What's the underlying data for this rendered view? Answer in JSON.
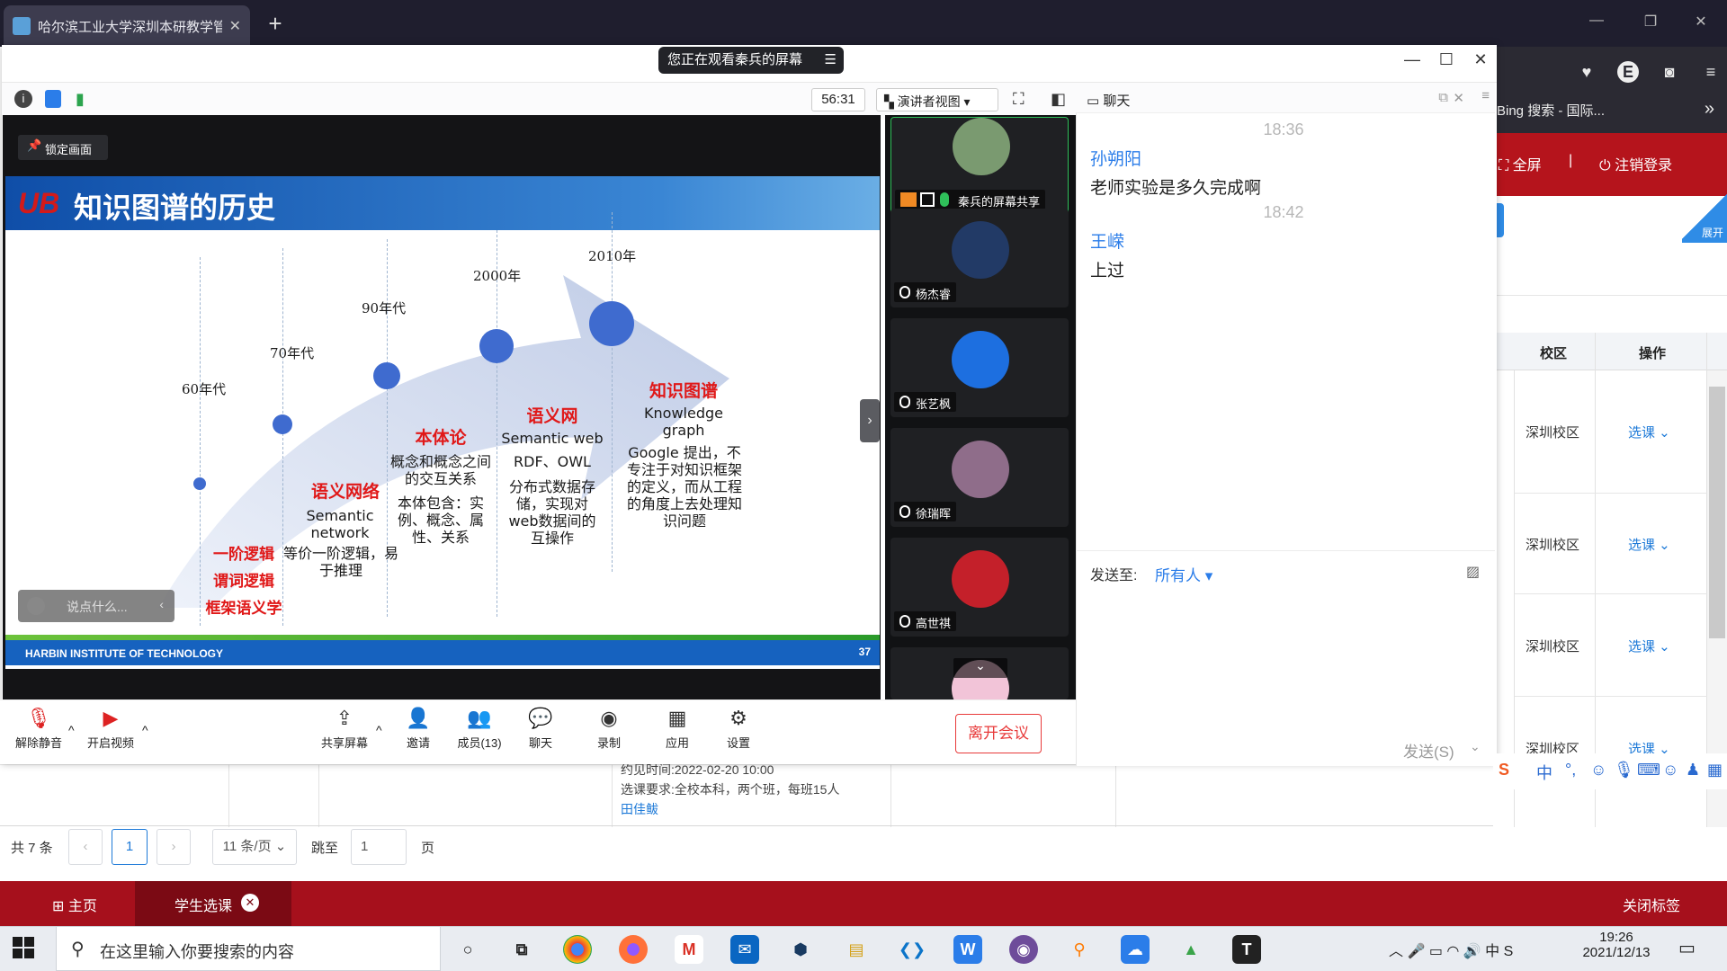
{
  "browser": {
    "tab_title": "哈尔滨工业大学深圳本研教学管",
    "bing_tab": "Bing 搜索 - 国际...",
    "nav_fullscreen": "全屏",
    "nav_logout": "注销登录",
    "expand_label": "展开"
  },
  "under_page": {
    "table_headers": [
      "校区",
      "操作"
    ],
    "rows": [
      {
        "campus": "深圳校区",
        "action": "选课 ⌄"
      },
      {
        "campus": "深圳校区",
        "action": "选课 ⌄"
      },
      {
        "campus": "深圳校区",
        "action": "选课 ⌄"
      },
      {
        "campus": "深圳校区",
        "action": "选课 ⌄"
      }
    ],
    "detail_line1": "约见时间:2022-02-20 10:00",
    "detail_line2": "选课要求:全校本科，两个班，每班15人",
    "detail_teacher": "田佳鲅",
    "pager": {
      "total": "共 7 条",
      "prev": "‹",
      "page": "1",
      "next": "›",
      "page_size": "11 条/页",
      "jump_label": "跳至",
      "jump_value": "1",
      "page_unit": "页"
    },
    "footer": {
      "home": "主页",
      "tab": "学生选课",
      "close_tabs": "关闭标签"
    }
  },
  "taskbar": {
    "search_placeholder": "在这里输入你要搜索的内容",
    "time": "19:26",
    "date": "2021/12/13",
    "ime_zh": "中",
    "ime_t": "T"
  },
  "meeting": {
    "watching_label": "您正在观看秦兵的屏幕",
    "timer": "56:31",
    "view_mode": "演讲者视图",
    "lock_label": "锁定画面",
    "say_placeholder": "说点什么...",
    "participants": [
      {
        "name": "秦兵的屏幕共享",
        "color": "#7a9a70"
      },
      {
        "name": "杨杰睿",
        "color": "#223a66"
      },
      {
        "name": "张艺枫",
        "color": "#1d6fe0"
      },
      {
        "name": "徐瑞晖",
        "color": "#8f6d8a"
      },
      {
        "name": "高世祺",
        "color": "#c4202a"
      }
    ],
    "toolbar": {
      "unmute": "解除静音",
      "video": "开启视频",
      "share": "共享屏幕",
      "invite": "邀请",
      "members": "成员(13)",
      "chat": "聊天",
      "record": "录制",
      "apps": "应用",
      "settings": "设置",
      "leave": "离开会议"
    },
    "chat": {
      "title": "聊天",
      "messages": [
        {
          "time": "18:36",
          "sender": "孙朔阳",
          "text": "老师实验是多久完成啊"
        },
        {
          "time": "18:42",
          "sender": "王嵘",
          "text": "上过"
        }
      ],
      "send_to_label": "发送至:",
      "send_to_value": "所有人 ▾",
      "send_button": "发送(S)"
    }
  },
  "slide": {
    "logo": "UB",
    "title": "知识图谱的历史",
    "footer": "HARBIN INSTITUTE OF TECHNOLOGY",
    "page_no": "37",
    "eras": [
      {
        "label": "60年代",
        "name_lines": [
          "一阶逻辑",
          "谓词逻辑",
          "框架语义学"
        ],
        "en": "",
        "desc": ""
      },
      {
        "label": "70年代",
        "name": "语义网络",
        "en": "Semantic network",
        "desc": "等价一阶逻辑，易于推理"
      },
      {
        "label": "90年代",
        "name": "本体论",
        "desc1": "概念和概念之间的交互关系",
        "desc2": "本体包含：实例、概念、属性、关系"
      },
      {
        "label": "2000年",
        "name": "语义网",
        "en": "Semantic web",
        "en2": "RDF、OWL",
        "desc": "分布式数据存储，实现对web数据间的互操作"
      },
      {
        "label": "2010年",
        "name": "知识图谱",
        "en": "Knowledge graph",
        "desc": "Google 提出，不专注于对知识框架的定义，而从工程的角度上去处理知识问题"
      }
    ]
  }
}
